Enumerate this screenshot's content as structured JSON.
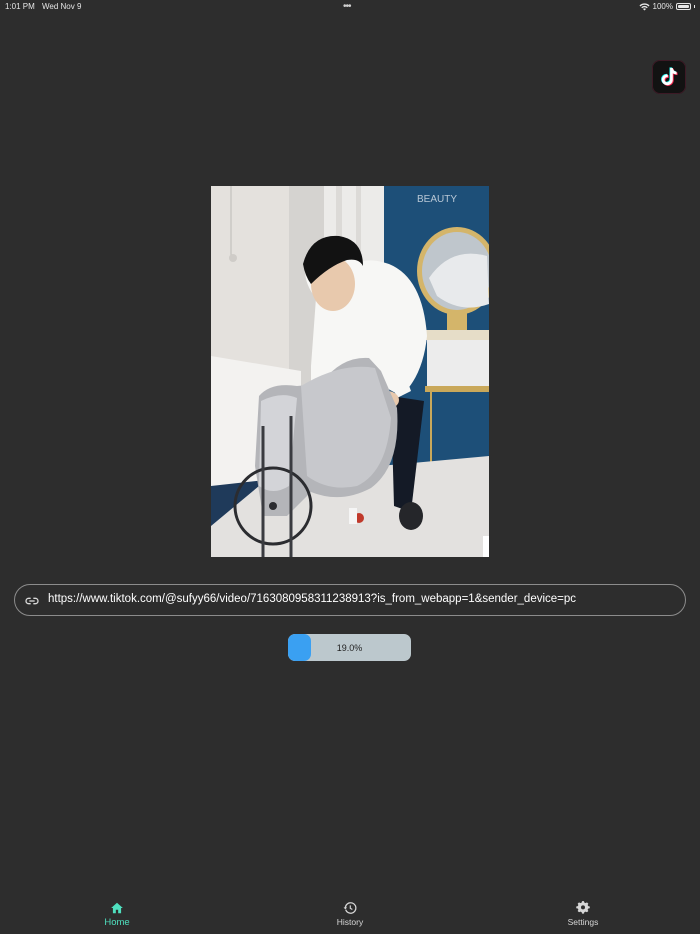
{
  "status_bar": {
    "time": "1:01 PM",
    "date": "Wed Nov 9",
    "multitask_dots": "•••",
    "battery": "100%"
  },
  "app_logo_icon": "tiktok-logo",
  "video": {
    "thumbnail_icon": "video-thumbnail",
    "sign_text": "BEAUTY"
  },
  "url_field": {
    "icon": "link-icon",
    "value": "https://www.tiktok.com/@sufyy66/video/7163080958311238913?is_from_webapp=1&sender_device=pc"
  },
  "progress": {
    "fraction": 0.19,
    "label": "19.0%"
  },
  "tab_bar": {
    "tabs": [
      {
        "label": "Home",
        "icon": "home-icon",
        "active": true
      },
      {
        "label": "History",
        "icon": "history-icon",
        "active": false
      },
      {
        "label": "Settings",
        "icon": "gear-icon",
        "active": false
      }
    ]
  },
  "colors": {
    "background": "#2d2d2d",
    "accent": "#4fe0bf",
    "progress_fill": "#3aa0f2",
    "progress_track": "#bcc8cd"
  }
}
